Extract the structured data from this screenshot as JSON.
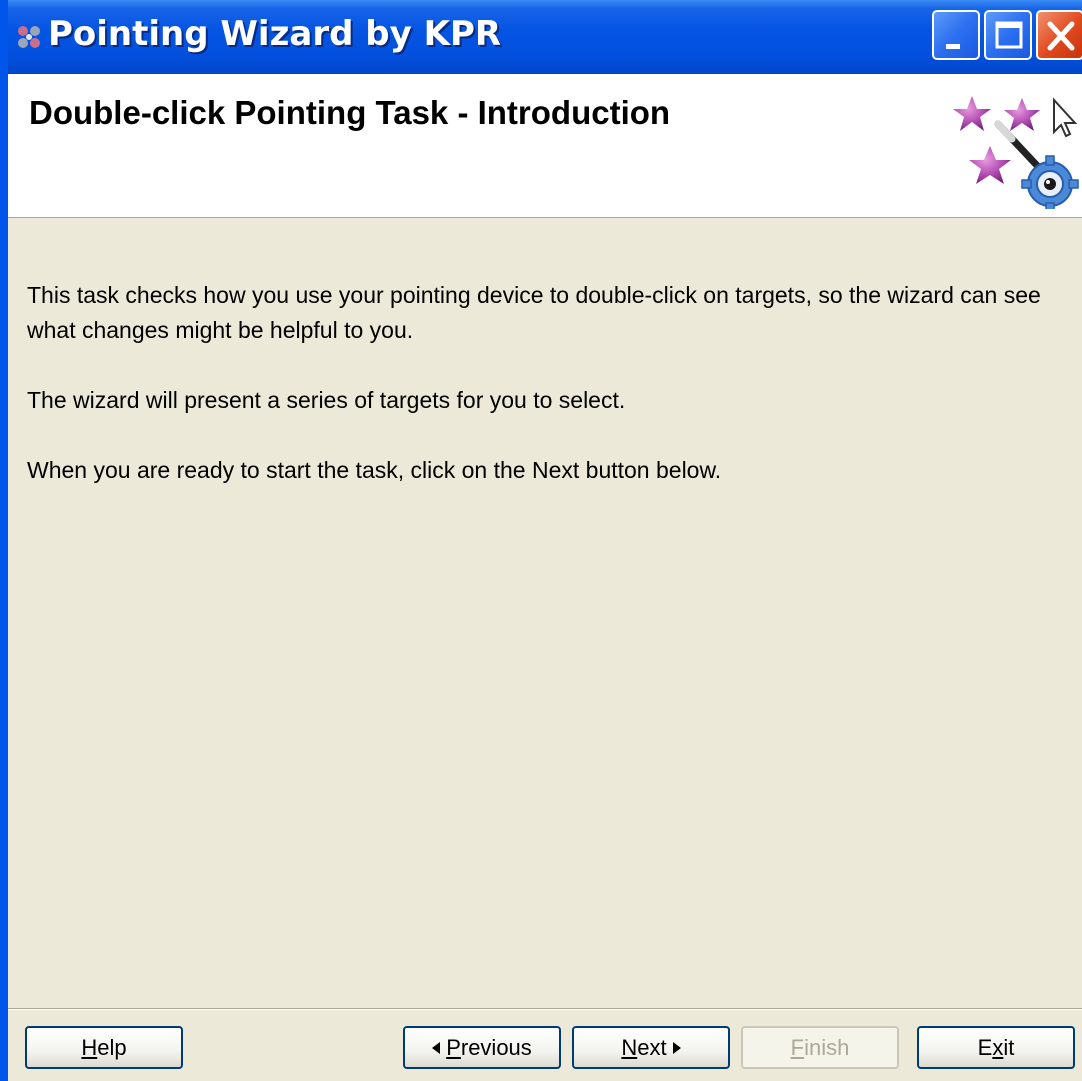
{
  "window": {
    "title": "Pointing Wizard by KPR",
    "controls": [
      "minimize-icon",
      "maximize-icon",
      "close-icon"
    ]
  },
  "header": {
    "title": "Double-click Pointing Task - Introduction",
    "logo_icon": "wizard-wand-icon"
  },
  "content": {
    "paragraphs": [
      "This task checks how you use your pointing device to double-click on targets, so the wizard can see what changes might be helpful to you.",
      "The wizard will present a series of targets for you to select.",
      "When you are ready to start the task, click on the Next button below."
    ]
  },
  "buttons": {
    "help": {
      "accel": "H",
      "rest": "elp"
    },
    "previous": {
      "accel": "P",
      "rest": "revious"
    },
    "next": {
      "accel": "N",
      "rest": "ext"
    },
    "finish": {
      "accel": "F",
      "rest": "inish"
    },
    "exit": {
      "pre": "E",
      "accel": "x",
      "rest": "it"
    }
  },
  "colors": {
    "titlebar": "#0554e3",
    "face": "#ece9d8",
    "close": "#e0491e"
  }
}
